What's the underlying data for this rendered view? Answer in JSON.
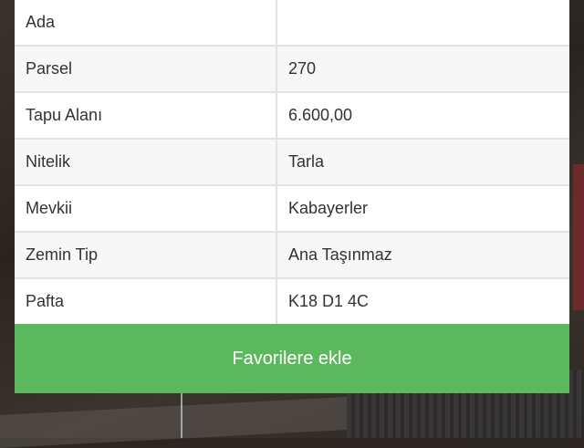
{
  "colors": {
    "button_green": "#5cb85c",
    "row_alt": "#f7f7f7",
    "border": "#e2e2e2",
    "text": "#333333"
  },
  "rows": [
    {
      "label": "Ada",
      "value": ""
    },
    {
      "label": "Parsel",
      "value": "270"
    },
    {
      "label": "Tapu Alanı",
      "value": "6.600,00"
    },
    {
      "label": "Nitelik",
      "value": "Tarla"
    },
    {
      "label": "Mevkii",
      "value": "Kabayerler"
    },
    {
      "label": "Zemin Tip",
      "value": "Ana Taşınmaz"
    },
    {
      "label": "Pafta",
      "value": "K18 D1 4C"
    }
  ],
  "favorite_button": {
    "label": "Favorilere ekle"
  }
}
